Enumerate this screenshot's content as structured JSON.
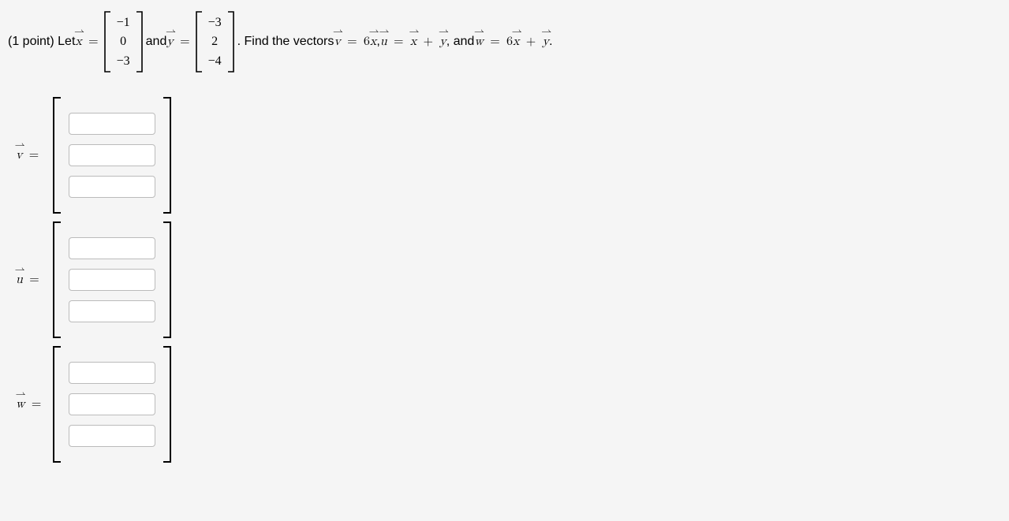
{
  "problem": {
    "points_prefix": "(1 point) Let ",
    "x_var": "x",
    "eq": "=",
    "x_vec": [
      "−1",
      "0",
      "−3"
    ],
    "and_y": " and ",
    "y_var": "y",
    "y_vec": [
      "−3",
      "2",
      "−4"
    ],
    "period_find": ". Find the vectors ",
    "v_var": "v",
    "v_def_rhs": "6",
    "v_def_rhs_var": "x",
    "comma1": ", ",
    "u_var": "u",
    "u_def_rhs_var1": "x",
    "u_def_rhs_var2": "y",
    "comma_and": ", and ",
    "w_var": "w",
    "w_def_rhs_coef": "6",
    "w_def_rhs_var1": "x",
    "w_def_rhs_var2": "y",
    "period": "."
  },
  "answers": {
    "v_label": "v",
    "u_label": "u",
    "w_label": "w"
  }
}
